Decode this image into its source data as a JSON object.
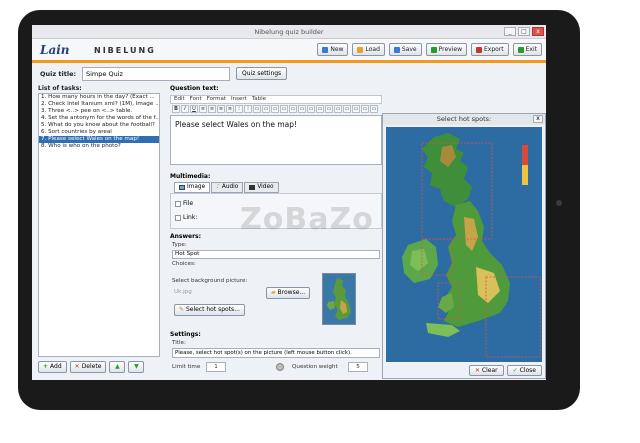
{
  "window": {
    "title": "Nibelung quiz builder",
    "btn_min": "_",
    "btn_max": "□",
    "btn_close": "x"
  },
  "header": {
    "logo": "Lain",
    "logo_sub": "NIBELUNG"
  },
  "toolbar": [
    {
      "label": "New",
      "icon_color": "#3a7bd5"
    },
    {
      "label": "Load",
      "icon_color": "#e2a32b"
    },
    {
      "label": "Save",
      "icon_color": "#3a7bd5"
    },
    {
      "label": "Preview",
      "icon_color": "#2b9a2b"
    },
    {
      "label": "Export",
      "icon_color": "#c0392b"
    },
    {
      "label": "Exit",
      "icon_color": "#2b9a2b"
    }
  ],
  "quiz": {
    "title_label": "Quiz title:",
    "title_value": "Simpe Quiz",
    "settings_button": "Quiz settings"
  },
  "tasks": {
    "label": "List of tasks:",
    "items": [
      "1. How many hours in the day? (Exact ...",
      "2. Check Intel Itanium xml? (1M), Image ...",
      "3. Three <..> pee on <..> table.",
      "4. Set the antonym for the words of the f...",
      "5. What do you know about the football?",
      "6. Sort countries by areal",
      "7. Please select Wales on the map!",
      "8. Who is who on the photo?"
    ],
    "selected_index": 6,
    "add_label": "Add",
    "delete_label": "Delete",
    "up_label": "▲",
    "down_label": "▼"
  },
  "question": {
    "label": "Question text:",
    "menu": [
      "Edit",
      "Font",
      "Format",
      "Insert",
      "Table"
    ],
    "format_buttons": [
      "B",
      "I",
      "U",
      "≡",
      "≡",
      "≡",
      "≡",
      "⁝",
      "⁝",
      "▭",
      "▭",
      "▭",
      "▭",
      "▭",
      "▭",
      "▭",
      "▭",
      "▭",
      "▭",
      "▭",
      "▭",
      "▭",
      "▭"
    ],
    "text": "Please select Wales on the map!"
  },
  "multimedia": {
    "label": "Multimedia:",
    "tabs": [
      "Image",
      "Audio",
      "Video"
    ],
    "active_tab": 0,
    "file_label": "File",
    "link_label": "Link:"
  },
  "answers": {
    "label": "Answers:",
    "type_label": "Type:",
    "type_value": "Hot Spot",
    "choices_label": "Choices:",
    "bg_picture_label": "Select background picture:",
    "bg_file": "Uk.jpg",
    "browse_label": "Browse...",
    "hotspots_label": "Select hot spots..."
  },
  "settings": {
    "label": "Settings:",
    "title_label": "Title:",
    "title_value": "Please, select hot spot(s) on the picture (left mouse button click).",
    "time_limit_label": "Limit time",
    "time_limit_value": "1",
    "weight_label": "Question weight",
    "weight_value": "5"
  },
  "hotspot_dialog": {
    "title": "Select hot spots:",
    "clear_label": "Clear",
    "close_label": "Close",
    "close_x": "x"
  },
  "watermark": "ZoBaZo"
}
